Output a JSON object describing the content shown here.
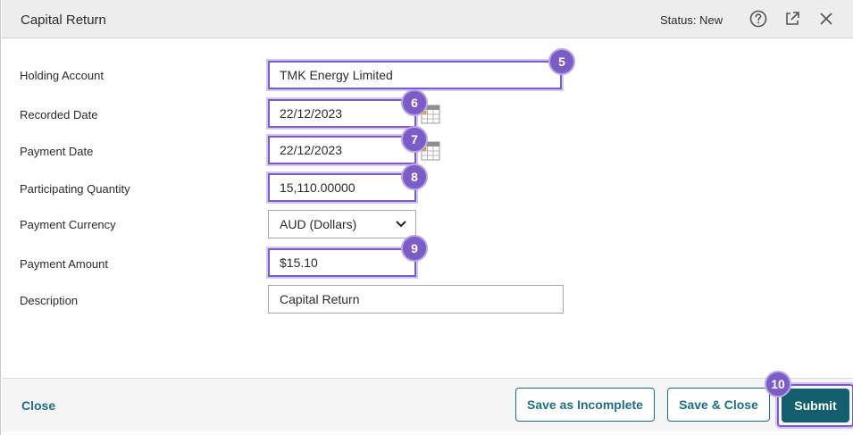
{
  "dialog": {
    "title": "Capital Return",
    "status": "Status: New"
  },
  "header_icons": [
    "help-icon",
    "open-external-icon",
    "close-icon"
  ],
  "form": {
    "holding_account": {
      "label": "Holding Account",
      "value": "TMK Energy Limited"
    },
    "recorded_date": {
      "label": "Recorded Date",
      "value": "22/12/2023"
    },
    "payment_date": {
      "label": "Payment Date",
      "value": "22/12/2023"
    },
    "participating_quantity": {
      "label": "Participating Quantity",
      "value": "15,110.00000"
    },
    "payment_currency": {
      "label": "Payment Currency",
      "value": "AUD (Dollars)"
    },
    "payment_amount": {
      "label": "Payment Amount",
      "value": "$15.10"
    },
    "description": {
      "label": "Description",
      "value": "Capital Return"
    }
  },
  "badges": [
    "5",
    "6",
    "7",
    "8",
    "9",
    "10"
  ],
  "footer": {
    "close_label": "Close",
    "save_incomplete_label": "Save as Incomplete",
    "save_close_label": "Save & Close",
    "submit_label": "Submit"
  },
  "colors": {
    "accent": "#135f70",
    "highlight": "#7a5bc8",
    "header_bg": "#ededee"
  }
}
